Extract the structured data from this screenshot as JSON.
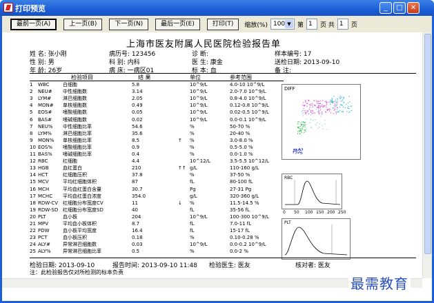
{
  "window": {
    "title": "打印预览",
    "min": "_",
    "max": "□",
    "close": "✕"
  },
  "toolbar": {
    "first": "最前一页(A)",
    "prev": "上一页(B)",
    "next": "下一页(N)",
    "last": "最后一页(E)",
    "print": "打印(T)",
    "zoom_label": "缩放(%)",
    "zoom_value": "100",
    "page_prefix": "第",
    "page_value": "1",
    "page_mid": "页 共",
    "page_total": "1",
    "page_suffix": "页"
  },
  "report": {
    "title": "上海市医友附属人民医院检验报告单",
    "name": "姓  名: 张小刚",
    "sex": "性  别: 男",
    "age": "年  龄: 26岁",
    "record": "病历号: 123456",
    "dept": "科  别: 内科",
    "bed": "病  床: 一病区01",
    "diag": "诊    断:",
    "doctor": "医  生: 康金",
    "specimen": "标  本: 血",
    "sample": "样本编号: 17",
    "senddate": "送检日期: 2013-09-10",
    "remark": "备    注:",
    "col_item": "检验项目",
    "col_result": "结 果",
    "col_unit": "单位",
    "col_ref": "参考范围",
    "rows": [
      [
        "1",
        "WBC",
        "白细胞",
        "5.8",
        "",
        "10^9/L",
        "4.0-10 10^9/L"
      ],
      [
        "2",
        "NEU#",
        "中性细胞数",
        "3.14",
        "",
        "10^9/L",
        "2.0-7.0 10^9/L"
      ],
      [
        "3",
        "LYM#",
        "淋巴细胞数",
        "2.05",
        "",
        "10^9/L",
        "0.8-4.0 10^9/L"
      ],
      [
        "4",
        "MON#",
        "单核细胞数",
        "0.49",
        "",
        "10^9/L",
        "0.12-0.8 10^9/L"
      ],
      [
        "5",
        "EOS#",
        "嗜酸细胞数",
        "0.05",
        "",
        "10^9/L",
        "0.02-0.5 10^9/L"
      ],
      [
        "6",
        "BAS#",
        "嗜碱细胞数",
        "0.02",
        "",
        "10^9/L",
        "0.0-0.1 10^9/L"
      ],
      [
        "7",
        "NEU%",
        "中性细胞比率",
        "54.6",
        "",
        "%",
        "50-70 %"
      ],
      [
        "8",
        "LYM%",
        "淋巴细胞比率",
        "35.6",
        "",
        "%",
        "20-40 %"
      ],
      [
        "9",
        "MON%",
        "单核细胞比率",
        "8.5",
        "↑",
        "%",
        "3.0-8.0 %"
      ],
      [
        "10",
        "EOS%",
        "嗜酸细胞比率",
        "0.9",
        "",
        "%",
        "0.5-5.0 %"
      ],
      [
        "11",
        "BAS%",
        "嗜碱细胞比率",
        "0.4",
        "",
        "%",
        "0.0-1.0 %"
      ],
      [
        "12",
        "RBC",
        "红细胞",
        "4.4",
        "",
        "10^12/L",
        "3.5-5.5 10^12/L"
      ],
      [
        "13",
        "HGB",
        "血红蛋白",
        "210",
        "↑↑",
        "g/L",
        "110-160 g/L"
      ],
      [
        "14",
        "HCT",
        "红细胞压积",
        "37.8",
        "",
        "%",
        "37-50 %"
      ],
      [
        "15",
        "MCV",
        "平均红细胞体积",
        "87",
        "",
        "fL",
        "80-100 fL"
      ],
      [
        "16",
        "MCH",
        "平均血红蛋白含量",
        "30.7",
        "",
        "Pg",
        "27-31 Pg"
      ],
      [
        "17",
        "MCHC",
        "平均血红蛋白浓度",
        "354.0",
        "",
        "g/L",
        "320-360 g/L"
      ],
      [
        "18",
        "RDW-CV",
        "红细胞分布宽度CV",
        "11",
        "↓",
        "%",
        "11.5-14.5 %"
      ],
      [
        "19",
        "RDW-SD",
        "红细胞分布宽度SD",
        "40",
        "",
        "fL",
        "35-56 fL"
      ],
      [
        "20",
        "PLT",
        "血小板",
        "204",
        "",
        "10^9/L",
        "100-300 10^9/L"
      ],
      [
        "21",
        "MPV",
        "平均血小板体积",
        "8.7",
        "",
        "fL",
        "7.0-11 fL"
      ],
      [
        "22",
        "PDW",
        "血小板平均宽度",
        "16.4",
        "",
        "fL",
        "15-17 fL"
      ],
      [
        "23",
        "PCT",
        "血小板压积",
        "0.18",
        "",
        "%",
        "0.10-0.28 %"
      ],
      [
        "24",
        "ALY#",
        "异常淋巴细胞数",
        "0.03",
        "",
        "10^9/L",
        "0.0-0.2 10^9/L"
      ],
      [
        "25",
        "ALY%",
        "异常淋巴细胞比率",
        "0.5",
        "",
        "%",
        "0.0-2 %"
      ]
    ],
    "diff_label": "DIFF",
    "rbc_label": "RBC",
    "plt_label": "PLT",
    "rbc_ticks": [
      "0",
      "50",
      "100",
      "150",
      "200",
      "250"
    ],
    "footer_date": "检验日期:  2013-09-10",
    "footer_time": "报告时间:  2013-09-10 11:48",
    "footer_doctor": "检验医生:  医友",
    "footer_checker": "核对者:  医友",
    "note": "注：此检验报告仅对所检测的标本负责"
  },
  "watermark": "最需教育",
  "colors": {
    "titlebar": "#1c5fd6",
    "toolbar": "#ece9d8",
    "watermark": "#2a4fb8"
  }
}
